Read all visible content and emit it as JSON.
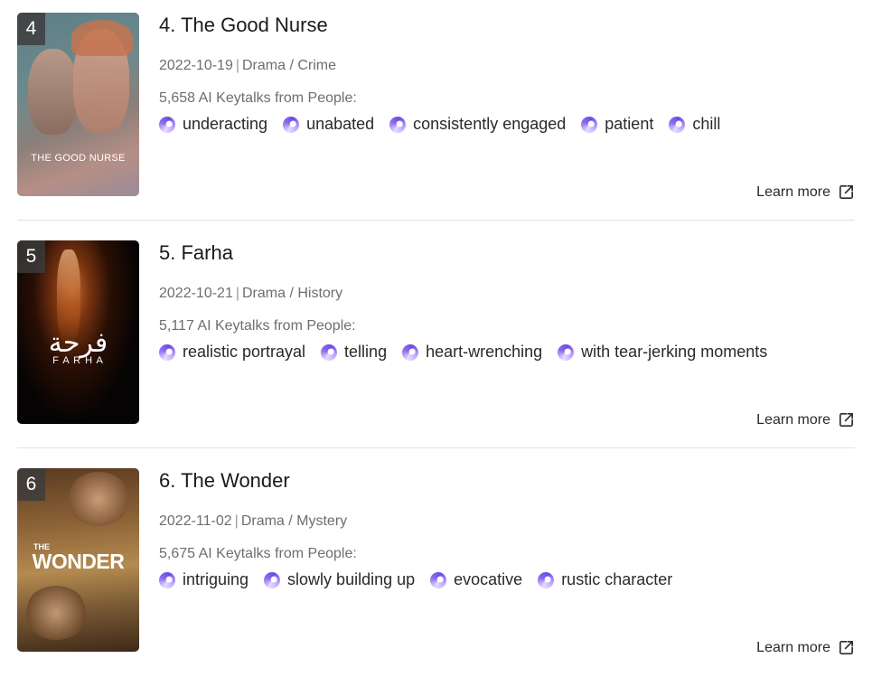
{
  "items": [
    {
      "rank": "4",
      "title": "4. The Good Nurse",
      "date": "2022-10-19",
      "sep": "|",
      "genres": "Drama / Crime",
      "keytalks": "5,658 AI Keytalks from People:",
      "tags": [
        "underacting",
        "unabated",
        "consistently engaged",
        "patient",
        "chill"
      ],
      "poster_text": "THE GOOD NURSE",
      "learn_more": "Learn more"
    },
    {
      "rank": "5",
      "title": "5. Farha",
      "date": "2022-10-21",
      "sep": "|",
      "genres": "Drama / History",
      "keytalks": "5,117 AI Keytalks from People:",
      "tags": [
        "realistic portrayal",
        "telling",
        "heart-wrenching",
        "with tear-jerking moments"
      ],
      "poster_text": "فرحة",
      "poster_subtext": "F A R H A",
      "learn_more": "Learn more"
    },
    {
      "rank": "6",
      "title": "6. The Wonder",
      "date": "2022-11-02",
      "sep": "|",
      "genres": "Drama / Mystery",
      "keytalks": "5,675 AI Keytalks from People:",
      "tags": [
        "intriguing",
        "slowly building up",
        "evocative",
        "rustic character"
      ],
      "poster_text_small": "THE",
      "poster_text": "WONDER",
      "learn_more": "Learn more"
    }
  ],
  "colors": {
    "accent": "#7b5cf0",
    "divider": "#e2e2e2",
    "muted": "#6e6e6e"
  },
  "icons": {
    "tag": "keytalk-swirl-icon",
    "learn_more": "external-link-icon"
  }
}
